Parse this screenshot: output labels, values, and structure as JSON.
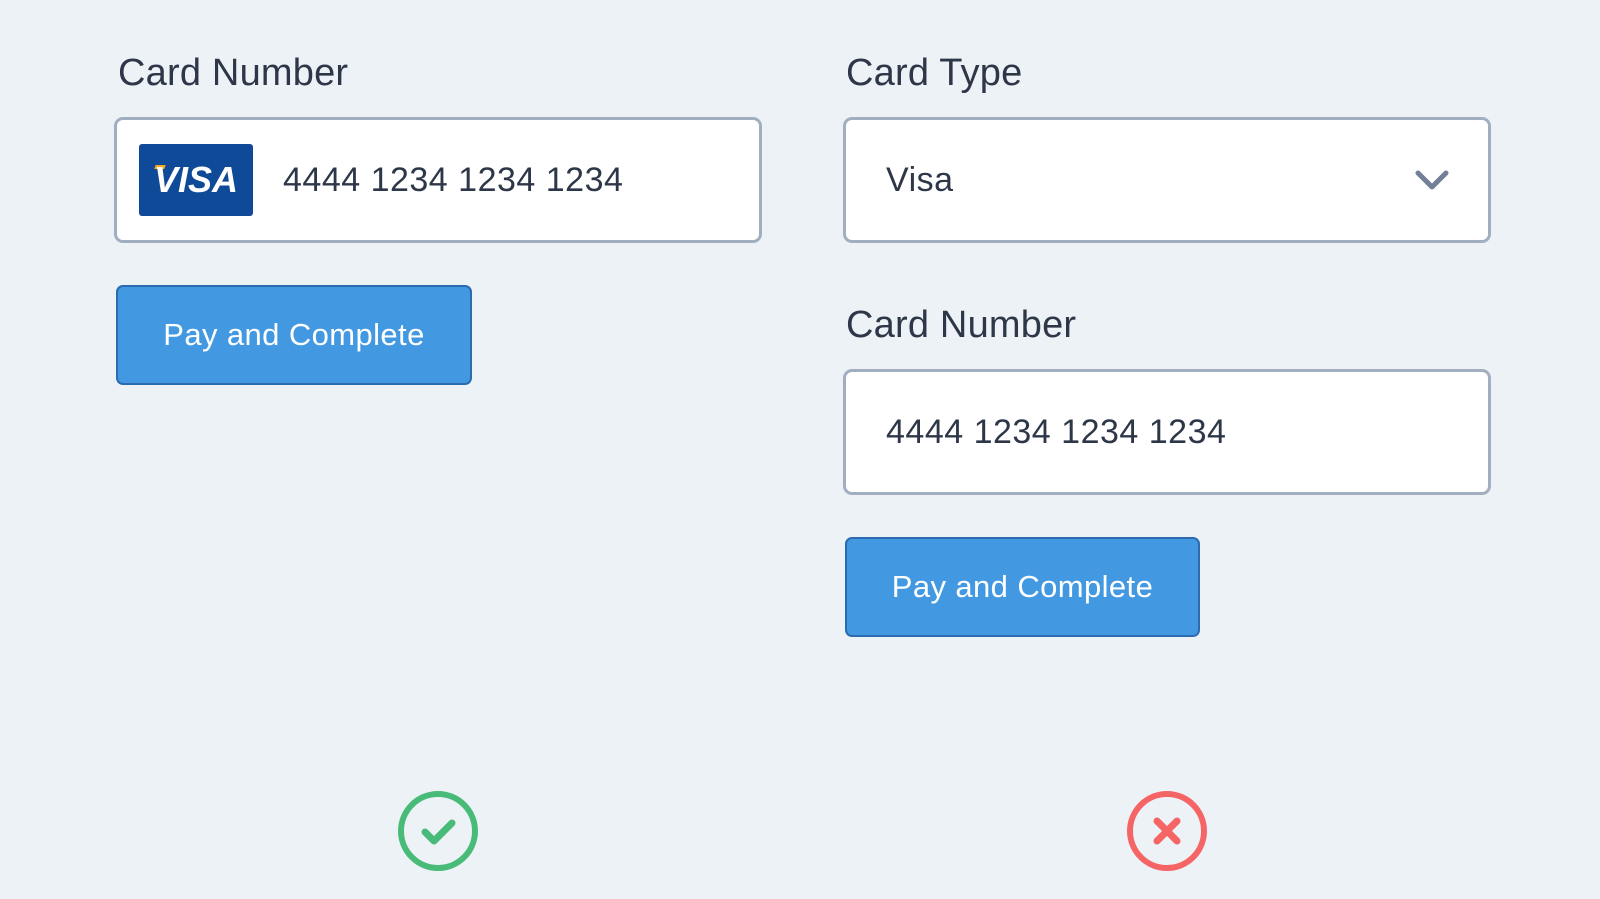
{
  "left_panel": {
    "card_number_label": "Card Number",
    "card_number_value": "4444 1234 1234 1234",
    "card_brand_logo": "VISA",
    "pay_button_label": "Pay and Complete",
    "status_icon": "check-circle-icon"
  },
  "right_panel": {
    "card_type_label": "Card Type",
    "card_type_value": "Visa",
    "card_number_label": "Card Number",
    "card_number_value": "4444 1234 1234 1234",
    "pay_button_label": "Pay and Complete",
    "status_icon": "x-circle-icon"
  },
  "colors": {
    "background": "#edf2f7",
    "text": "#2d3748",
    "field_border": "#a0aec0",
    "button": "#4299e1",
    "button_border": "#2b6cb0",
    "visa_blue": "#0f4a99",
    "success": "#48bb78",
    "error": "#f56565"
  }
}
